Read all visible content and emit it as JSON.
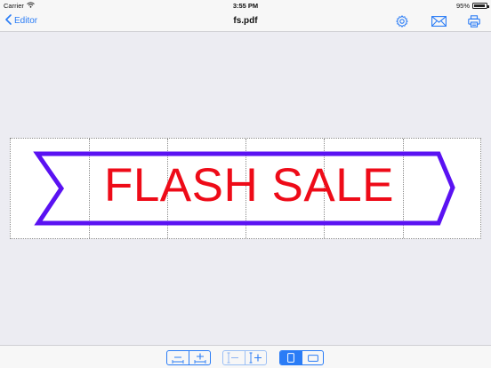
{
  "status_bar": {
    "carrier": "Carrier",
    "time": "3:55 PM",
    "battery": "95%",
    "battery_level": 0.95
  },
  "nav_bar": {
    "back_label": "Editor",
    "title": "fs.pdf",
    "icons": [
      "gear-icon",
      "mail-icon",
      "printer-icon"
    ]
  },
  "document": {
    "banner_text": "FLASH SALE",
    "text_color": "#ee0b18",
    "outline_color": "#5a12f2",
    "page_columns": 6
  },
  "toolbar": {
    "groups": [
      {
        "name": "width-controls",
        "buttons": [
          "decrease-width",
          "increase-width"
        ]
      },
      {
        "name": "height-controls",
        "buttons": [
          "decrease-height",
          "increase-height"
        ]
      },
      {
        "name": "orientation",
        "buttons": [
          "portrait",
          "landscape"
        ],
        "selected": "portrait"
      }
    ]
  },
  "colors": {
    "accent": "#2a7cf6",
    "background": "#ececf2"
  }
}
